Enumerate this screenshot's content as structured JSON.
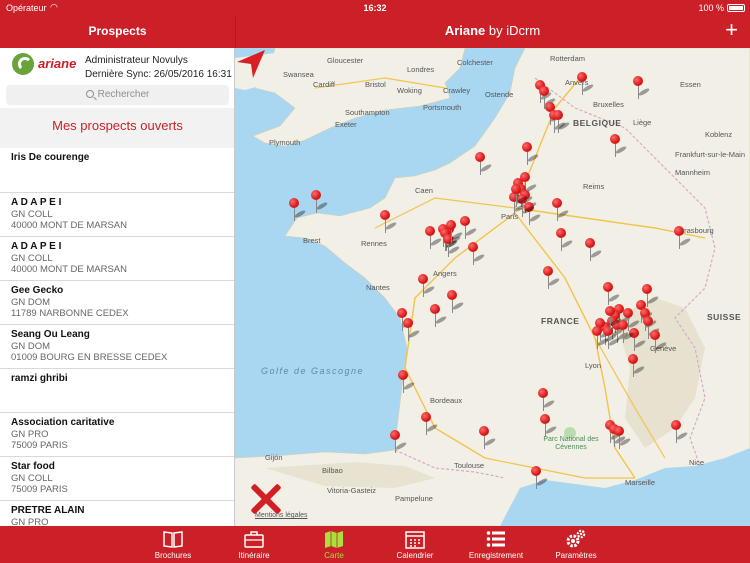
{
  "status_bar": {
    "carrier": "Opérateur",
    "time": "16:32",
    "battery": "100 %"
  },
  "nav": {
    "left_title": "Prospects",
    "app_name": "Ariane",
    "app_suffix": " by iDcrm",
    "add_label": "+"
  },
  "profile": {
    "logo_text": "ariane",
    "name": "Administrateur Novulys",
    "sync": "Dernière Sync: 26/05/2016 16:31"
  },
  "search": {
    "placeholder": "Rechercher"
  },
  "section_title": "Mes prospects ouverts",
  "prospects": [
    {
      "name": "Iris De courenge",
      "line1": "",
      "line2": ""
    },
    {
      "name": "A D A P E I",
      "line1": "GN COLL",
      "line2": "40000 MONT DE MARSAN"
    },
    {
      "name": "A D A P E I",
      "line1": "GN COLL",
      "line2": "40000 MONT DE MARSAN"
    },
    {
      "name": "Gee Gecko",
      "line1": "GN DOM",
      "line2": "11789 NARBONNE CEDEX"
    },
    {
      "name": "Seang Ou Leang",
      "line1": "GN DOM",
      "line2": "01009 BOURG EN BRESSE CEDEX"
    },
    {
      "name": "ramzi ghribi",
      "line1": "",
      "line2": ""
    },
    {
      "name": "Association caritative",
      "line1": "GN PRO",
      "line2": "75009 PARIS"
    },
    {
      "name": "Star food",
      "line1": "GN COLL",
      "line2": "75009 PARIS"
    },
    {
      "name": "PRETRE ALAIN",
      "line1": "GN PRO",
      "line2": ""
    }
  ],
  "map": {
    "labels": {
      "gloucester": "Gloucester",
      "londres": "Londres",
      "colchester": "Colchester",
      "rotterdam": "Rotterdam",
      "swansea": "Swansea",
      "cardiff": "Cardiff",
      "bristol": "Bristol",
      "woking": "Woking",
      "crawley": "Crawley",
      "ostende": "Ostende",
      "anvers": "Anvers",
      "essen": "Essen",
      "portsmouth": "Portsmouth",
      "southampton": "Southampton",
      "exeter": "Exeter",
      "bruxelles": "Bruxelles",
      "belgique": "BELGIQUE",
      "plymouth": "Plymouth",
      "liege": "Liège",
      "koblenz": "Koblenz",
      "frankfurt": "Frankfurt-sur-le-Main",
      "mannheim": "Mannheim",
      "reims": "Reims",
      "caen": "Caen",
      "paris": "Paris",
      "brest": "Brest",
      "rennes": "Rennes",
      "angers": "Angers",
      "strasbourg": "Strasbourg",
      "nantes": "Nantes",
      "france": "FRANCE",
      "suisse": "SUISSE",
      "geneve": "Genève",
      "golfe": "Golfe de Gascogne",
      "lyon": "Lyon",
      "bordeaux": "Bordeaux",
      "parc": "Parc National des Cévennes",
      "gijon": "Gijón",
      "bilbao": "Bilbao",
      "toulouse": "Toulouse",
      "vitoria": "Vitoria-Gasteiz",
      "pampelune": "Pampelune",
      "nice": "Nice",
      "marseille": "Marseille",
      "legal": "Mentions légales"
    },
    "pin_count": 70
  },
  "tabs": [
    {
      "label": "Brochures",
      "icon": "book-icon"
    },
    {
      "label": "Itinéraire",
      "icon": "briefcase-icon"
    },
    {
      "label": "Carte",
      "icon": "map-icon",
      "active": true
    },
    {
      "label": "Calendrier",
      "icon": "calendar-icon"
    },
    {
      "label": "Enregistrement",
      "icon": "list-icon"
    },
    {
      "label": "Paramètres",
      "icon": "gears-icon"
    }
  ],
  "colors": {
    "brand_red": "#cb2027",
    "active_tab": "#a8e03c",
    "sea": "#a9d7f2",
    "land": "#f2efe6",
    "logo_green": "#6aa33a"
  }
}
